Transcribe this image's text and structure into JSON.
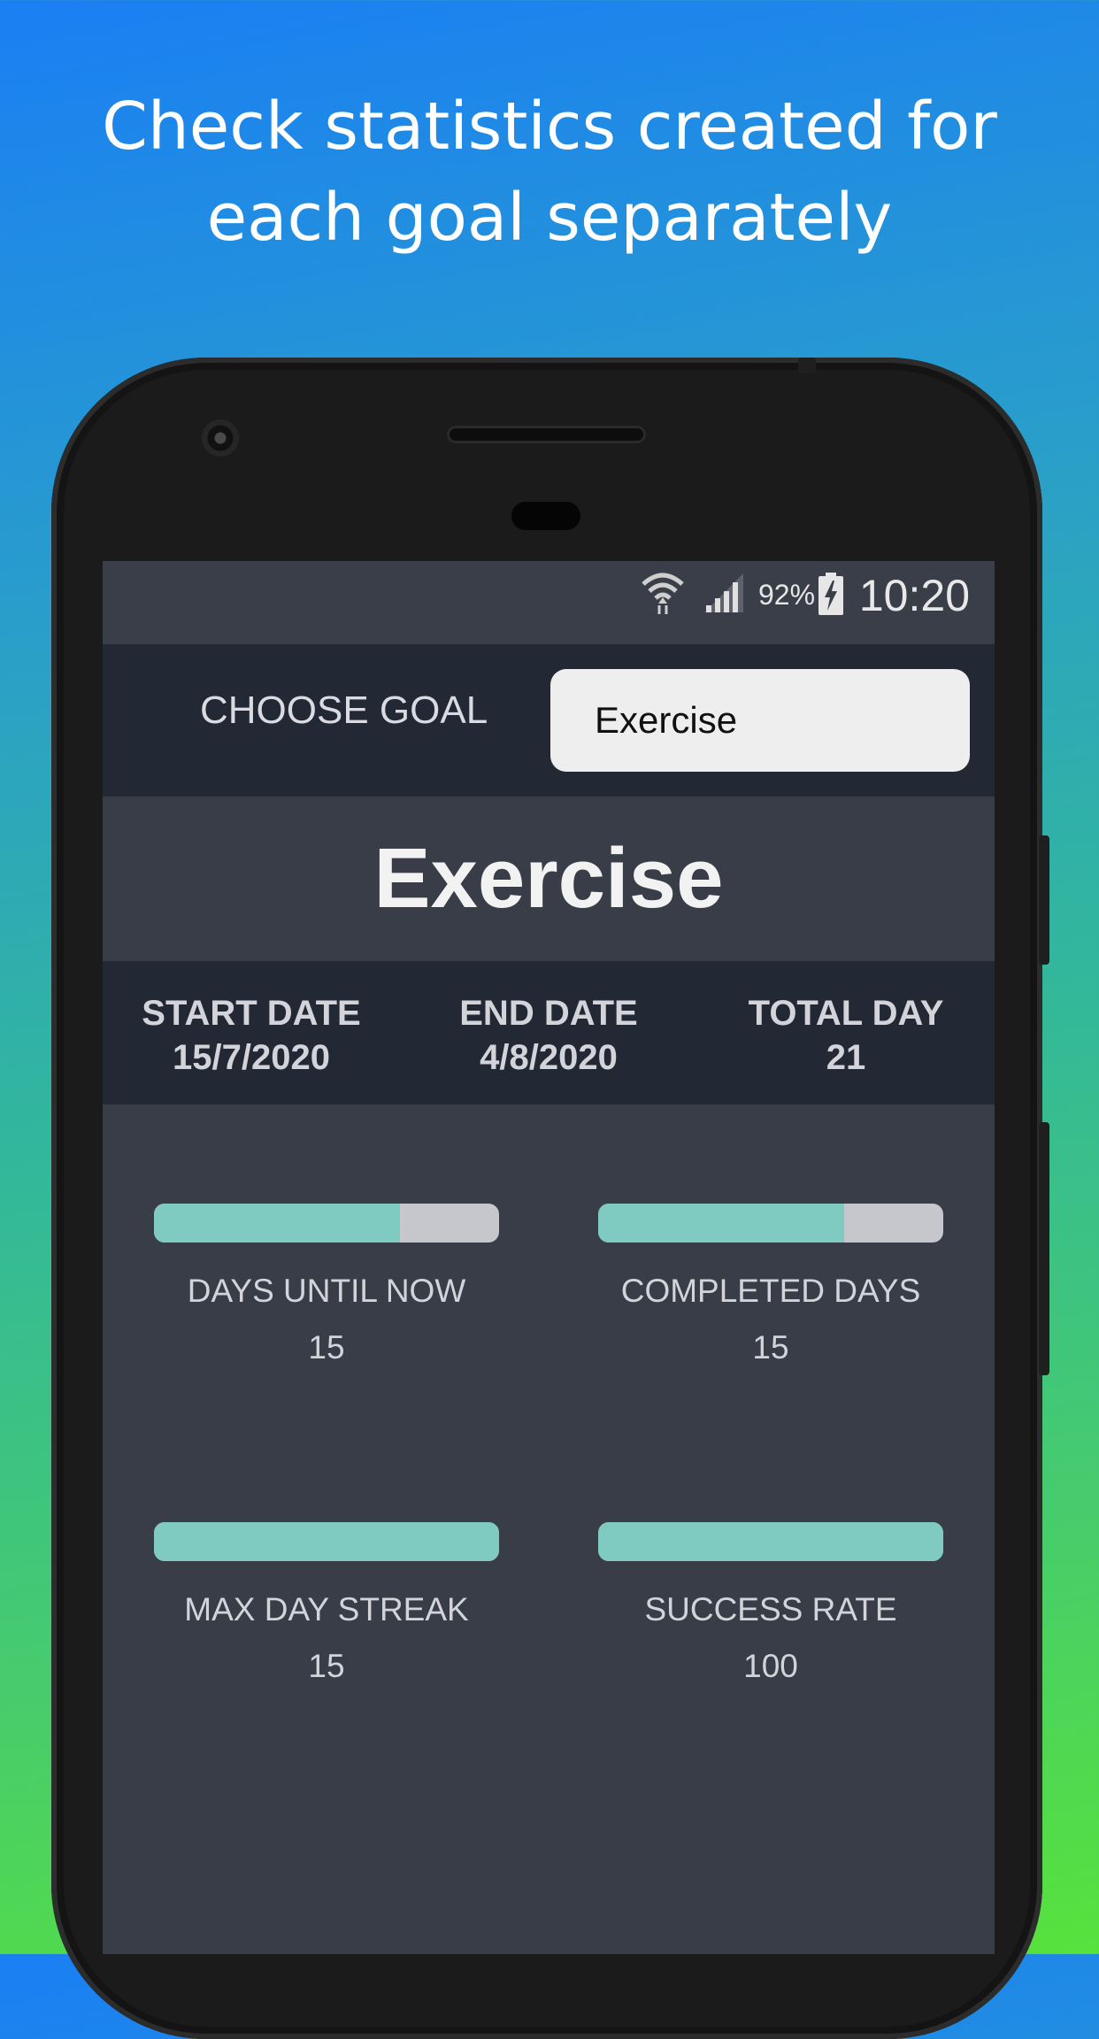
{
  "headline": {
    "line1": "Check statistics created for",
    "line2": "each goal separately"
  },
  "status_bar": {
    "battery_percent": "92%",
    "time": "10:20",
    "icons": [
      "wifi-icon",
      "signal-icon",
      "battery-charging-icon"
    ]
  },
  "goal_selector": {
    "label": "CHOOSE GOAL",
    "selected": "Exercise"
  },
  "goal": {
    "title": "Exercise"
  },
  "dates": {
    "start": {
      "label": "START DATE",
      "value": "15/7/2020"
    },
    "end": {
      "label": "END DATE",
      "value": "4/8/2020"
    },
    "total": {
      "label": "TOTAL DAY",
      "value": "21"
    }
  },
  "stats": [
    {
      "label": "DAYS UNTIL NOW",
      "value": "15",
      "progress": 0.714
    },
    {
      "label": "COMPLETED DAYS",
      "value": "15",
      "progress": 0.714
    },
    {
      "label": "MAX DAY STREAK",
      "value": "15",
      "progress": 1.0
    },
    {
      "label": "SUCCESS RATE",
      "value": "100",
      "progress": 1.0
    }
  ],
  "colors": {
    "bar_fill": "#7fcbc1",
    "bar_track": "#c6c7cc",
    "screen_bg": "#393d48",
    "panel_bg": "#222834"
  }
}
